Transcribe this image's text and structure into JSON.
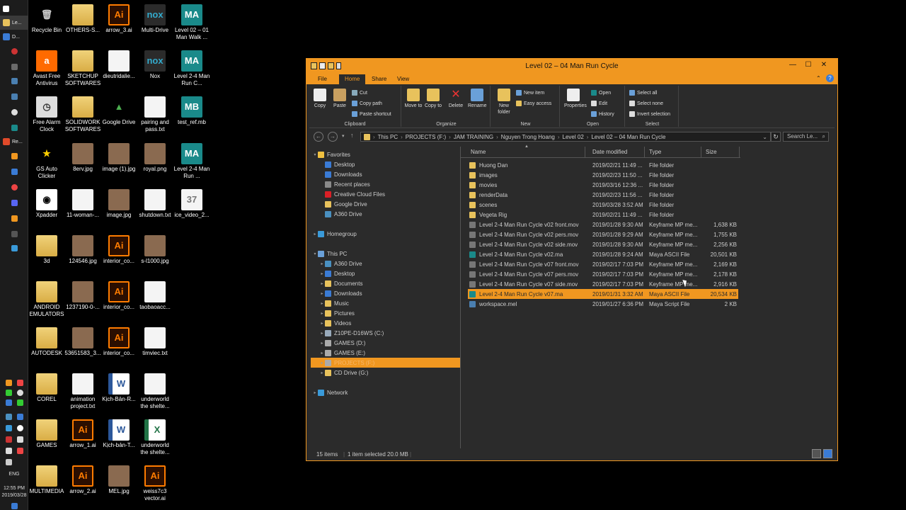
{
  "taskbar": {
    "items": [
      {
        "label": ""
      },
      {
        "label": "Le..."
      },
      {
        "label": "D..."
      },
      {
        "label": "Re..."
      }
    ],
    "lang": "ENG",
    "time": "12:55 PM",
    "date": "2019/03/28"
  },
  "desktop": {
    "icons": [
      {
        "label": "Recycle Bin",
        "type": "recycle",
        "glyph": "🗑"
      },
      {
        "label": "OTHERS-S...",
        "type": "folder",
        "glyph": ""
      },
      {
        "label": "arrow_3.ai",
        "type": "ai",
        "glyph": "Ai"
      },
      {
        "label": "Multi-Drive",
        "type": "nox",
        "glyph": "nox"
      },
      {
        "label": "Level 02 – 01 Man Walk ...",
        "type": "ma",
        "glyph": "MA"
      },
      {
        "label": "Avast Free Antivirus",
        "type": "avast",
        "glyph": "a"
      },
      {
        "label": "SKETCHUP SOFTWARES",
        "type": "folder",
        "glyph": ""
      },
      {
        "label": "dieutridalie...",
        "type": "doc",
        "glyph": ""
      },
      {
        "label": "Nox",
        "type": "nox",
        "glyph": "nox"
      },
      {
        "label": "Level 2-4 Man Run C...",
        "type": "ma",
        "glyph": "MA"
      },
      {
        "label": "Free Alarm Clock",
        "type": "clock",
        "glyph": "◷"
      },
      {
        "label": "SOLIDWORK SOFTWARES",
        "type": "folder",
        "glyph": ""
      },
      {
        "label": "Google Drive",
        "type": "drive",
        "glyph": "▲"
      },
      {
        "label": "pairing and pass.txt",
        "type": "doc",
        "glyph": ""
      },
      {
        "label": "test_ref.mb",
        "type": "ma",
        "glyph": "MB"
      },
      {
        "label": "GS Auto Clicker",
        "type": "star",
        "glyph": "★"
      },
      {
        "label": "8erv.jpg",
        "type": "img",
        "glyph": ""
      },
      {
        "label": "image (1).jpg",
        "type": "img",
        "glyph": ""
      },
      {
        "label": "royal.png",
        "type": "img",
        "glyph": ""
      },
      {
        "label": "Level 2-4 Man Run ...",
        "type": "ma",
        "glyph": "MA"
      },
      {
        "label": "Xpadder",
        "type": "xpadder",
        "glyph": "◉"
      },
      {
        "label": "11-woman-...",
        "type": "doc",
        "glyph": ""
      },
      {
        "label": "image.jpg",
        "type": "img",
        "glyph": ""
      },
      {
        "label": "shutdown.txt",
        "type": "doc",
        "glyph": ""
      },
      {
        "label": "ice_video_2...",
        "type": "doc",
        "glyph": "37"
      },
      {
        "label": "3d",
        "type": "folder",
        "glyph": ""
      },
      {
        "label": "124546.jpg",
        "type": "img",
        "glyph": ""
      },
      {
        "label": "interior_co...",
        "type": "ai",
        "glyph": "Ai"
      },
      {
        "label": "s-l1000.jpg",
        "type": "img",
        "glyph": ""
      },
      {
        "label": "ANDROID EMULATORS",
        "type": "folder",
        "glyph": ""
      },
      {
        "label": "1237190-0-...",
        "type": "img",
        "glyph": ""
      },
      {
        "label": "interior_co...",
        "type": "ai",
        "glyph": "Ai"
      },
      {
        "label": "taobaoacc...",
        "type": "doc",
        "glyph": ""
      },
      {
        "label": "AUTODESK",
        "type": "folder",
        "glyph": ""
      },
      {
        "label": "53651583_3...",
        "type": "img",
        "glyph": ""
      },
      {
        "label": "interior_co...",
        "type": "ai",
        "glyph": "Ai"
      },
      {
        "label": "timviec.txt",
        "type": "doc",
        "glyph": ""
      },
      {
        "label": "COREL",
        "type": "folder",
        "glyph": ""
      },
      {
        "label": "animation project.txt",
        "type": "doc",
        "glyph": ""
      },
      {
        "label": "Kịch-Bản-R...",
        "type": "word",
        "glyph": "W"
      },
      {
        "label": "underworld the shelte...",
        "type": "doc",
        "glyph": ""
      },
      {
        "label": "GAMES",
        "type": "folder",
        "glyph": ""
      },
      {
        "label": "arrow_1.ai",
        "type": "ai",
        "glyph": "Ai"
      },
      {
        "label": "Kịch-bản-T...",
        "type": "word",
        "glyph": "W"
      },
      {
        "label": "underworld the shelte...",
        "type": "excel",
        "glyph": "X"
      },
      {
        "label": "MULTIMEDIA",
        "type": "folder",
        "glyph": ""
      },
      {
        "label": "arrow_2.ai",
        "type": "ai",
        "glyph": "Ai"
      },
      {
        "label": "MEL.jpg",
        "type": "img",
        "glyph": ""
      },
      {
        "label": "weiss7c3 vector.ai",
        "type": "ai",
        "glyph": "Ai"
      }
    ]
  },
  "window": {
    "title": "Level 02 – 04 Man Run Cycle",
    "controls": {
      "minimize": "—",
      "maximize": "☐",
      "close": "✕"
    },
    "tabs": [
      "File",
      "Home",
      "Share",
      "View"
    ],
    "active_tab": "Home",
    "ribbon": {
      "clipboard": {
        "label": "Clipboard",
        "copy": "Copy",
        "paste": "Paste",
        "cut": "Cut",
        "copy_path": "Copy path",
        "paste_shortcut": "Paste shortcut"
      },
      "organize": {
        "label": "Organize",
        "move_to": "Move to",
        "copy_to": "Copy to",
        "delete": "Delete",
        "rename": "Rename"
      },
      "new": {
        "label": "New",
        "new_folder": "New folder",
        "new_item": "New item",
        "easy_access": "Easy access"
      },
      "open": {
        "label": "Open",
        "properties": "Properties",
        "open": "Open",
        "edit": "Edit",
        "history": "History"
      },
      "select": {
        "label": "Select",
        "select_all": "Select all",
        "select_none": "Select none",
        "invert": "Invert selection"
      }
    },
    "address": {
      "path": [
        "This PC",
        "PROJECTS (F:)",
        "JAM TRAINING",
        "Nguyen Trong Hoang",
        "Level 02",
        "Level 02 – 04 Man Run Cycle"
      ],
      "search_placeholder": "Search Le..."
    },
    "nav": [
      {
        "label": "Favorites",
        "indent": 0,
        "arrow": "▾",
        "icon": "#f0c040"
      },
      {
        "label": "Desktop",
        "indent": 1,
        "arrow": "",
        "icon": "#3a7bd5"
      },
      {
        "label": "Downloads",
        "indent": 1,
        "arrow": "",
        "icon": "#3a7bd5"
      },
      {
        "label": "Recent places",
        "indent": 1,
        "arrow": "",
        "icon": "#8a8a8a"
      },
      {
        "label": "Creative Cloud Files",
        "indent": 1,
        "arrow": "",
        "icon": "#da1f26"
      },
      {
        "label": "Google Drive",
        "indent": 1,
        "arrow": "",
        "icon": "#e8c25c"
      },
      {
        "label": "A360 Drive",
        "indent": 1,
        "arrow": "",
        "icon": "#4a90c0"
      },
      {
        "label": "",
        "indent": 0,
        "arrow": "",
        "icon": ""
      },
      {
        "label": "Homegroup",
        "indent": 0,
        "arrow": "▸",
        "icon": "#3a9ad9"
      },
      {
        "label": "",
        "indent": 0,
        "arrow": "",
        "icon": ""
      },
      {
        "label": "This PC",
        "indent": 0,
        "arrow": "▾",
        "icon": "#6aa0d8"
      },
      {
        "label": "A360 Drive",
        "indent": 1,
        "arrow": "▸",
        "icon": "#4a90c0"
      },
      {
        "label": "Desktop",
        "indent": 1,
        "arrow": "▸",
        "icon": "#3a7bd5"
      },
      {
        "label": "Documents",
        "indent": 1,
        "arrow": "▸",
        "icon": "#e8c25c"
      },
      {
        "label": "Downloads",
        "indent": 1,
        "arrow": "▸",
        "icon": "#3a7bd5"
      },
      {
        "label": "Music",
        "indent": 1,
        "arrow": "▸",
        "icon": "#e8c25c"
      },
      {
        "label": "Pictures",
        "indent": 1,
        "arrow": "▸",
        "icon": "#e8c25c"
      },
      {
        "label": "Videos",
        "indent": 1,
        "arrow": "▸",
        "icon": "#e8c25c"
      },
      {
        "label": "Z10PE-D16WS (C:)",
        "indent": 1,
        "arrow": "▸",
        "icon": "#9ab"
      },
      {
        "label": "GAMES (D:)",
        "indent": 1,
        "arrow": "▸",
        "icon": "#aaa"
      },
      {
        "label": "GAMES (E:)",
        "indent": 1,
        "arrow": "▸",
        "icon": "#aaa"
      },
      {
        "label": "PROJECTS (F:)",
        "indent": 1,
        "arrow": "▸",
        "icon": "#aaa",
        "selected": true
      },
      {
        "label": "CD Drive (G:)",
        "indent": 1,
        "arrow": "▸",
        "icon": "#e8c25c"
      },
      {
        "label": "",
        "indent": 0,
        "arrow": "",
        "icon": ""
      },
      {
        "label": "Network",
        "indent": 0,
        "arrow": "▸",
        "icon": "#3a9ad9"
      }
    ],
    "columns": [
      "Name",
      "Date modified",
      "Type",
      "Size"
    ],
    "files": [
      {
        "name": "Huong Dan",
        "date": "2019/02/21 11:49 ...",
        "type": "File folder",
        "size": "",
        "kind": "folder"
      },
      {
        "name": "images",
        "date": "2019/02/23 11:50 ...",
        "type": "File folder",
        "size": "",
        "kind": "folder"
      },
      {
        "name": "movies",
        "date": "2019/03/16 12:36 ...",
        "type": "File folder",
        "size": "",
        "kind": "folder"
      },
      {
        "name": "renderData",
        "date": "2019/02/23 11:56 ...",
        "type": "File folder",
        "size": "",
        "kind": "folder"
      },
      {
        "name": "scenes",
        "date": "2019/03/28 3:52 AM",
        "type": "File folder",
        "size": "",
        "kind": "folder"
      },
      {
        "name": "Vegeta Rig",
        "date": "2019/02/21 11:49 ...",
        "type": "File folder",
        "size": "",
        "kind": "folder"
      },
      {
        "name": "Level 2-4 Man Run Cycle v02 front.mov",
        "date": "2019/01/28 9:30 AM",
        "type": "Keyframe MP me...",
        "size": "1,638 KB",
        "kind": "mov"
      },
      {
        "name": "Level 2-4 Man Run Cycle v02 pers.mov",
        "date": "2019/01/28 9:29 AM",
        "type": "Keyframe MP me...",
        "size": "1,755 KB",
        "kind": "mov"
      },
      {
        "name": "Level 2-4 Man Run Cycle v02 side.mov",
        "date": "2019/01/28 9:30 AM",
        "type": "Keyframe MP me...",
        "size": "2,256 KB",
        "kind": "mov"
      },
      {
        "name": "Level 2-4 Man Run Cycle v02.ma",
        "date": "2019/01/28 9:24 AM",
        "type": "Maya ASCII File",
        "size": "20,501 KB",
        "kind": "ma"
      },
      {
        "name": "Level 2-4 Man Run Cycle v07 front.mov",
        "date": "2019/02/17 7:03 PM",
        "type": "Keyframe MP me...",
        "size": "2,169 KB",
        "kind": "mov"
      },
      {
        "name": "Level 2-4 Man Run Cycle v07 pers.mov",
        "date": "2019/02/17 7:03 PM",
        "type": "Keyframe MP me...",
        "size": "2,178 KB",
        "kind": "mov"
      },
      {
        "name": "Level 2-4 Man Run Cycle v07 side.mov",
        "date": "2019/02/17 7:03 PM",
        "type": "Keyframe MP me...",
        "size": "2,916 KB",
        "kind": "mov"
      },
      {
        "name": "Level 2-4 Man Run Cycle v07.ma",
        "date": "2019/01/31 3:32 AM",
        "type": "Maya ASCII File",
        "size": "20,534 KB",
        "kind": "ma",
        "selected": true
      },
      {
        "name": "workspace.mel",
        "date": "2019/01/27 6:36 PM",
        "type": "Maya Script File",
        "size": "2 KB",
        "kind": "mel"
      }
    ],
    "status": {
      "count": "15 items",
      "selected": "1 item selected  20.0 MB"
    }
  },
  "colors": {
    "accent": "#f09720",
    "window_bg": "#2b2b2b"
  }
}
